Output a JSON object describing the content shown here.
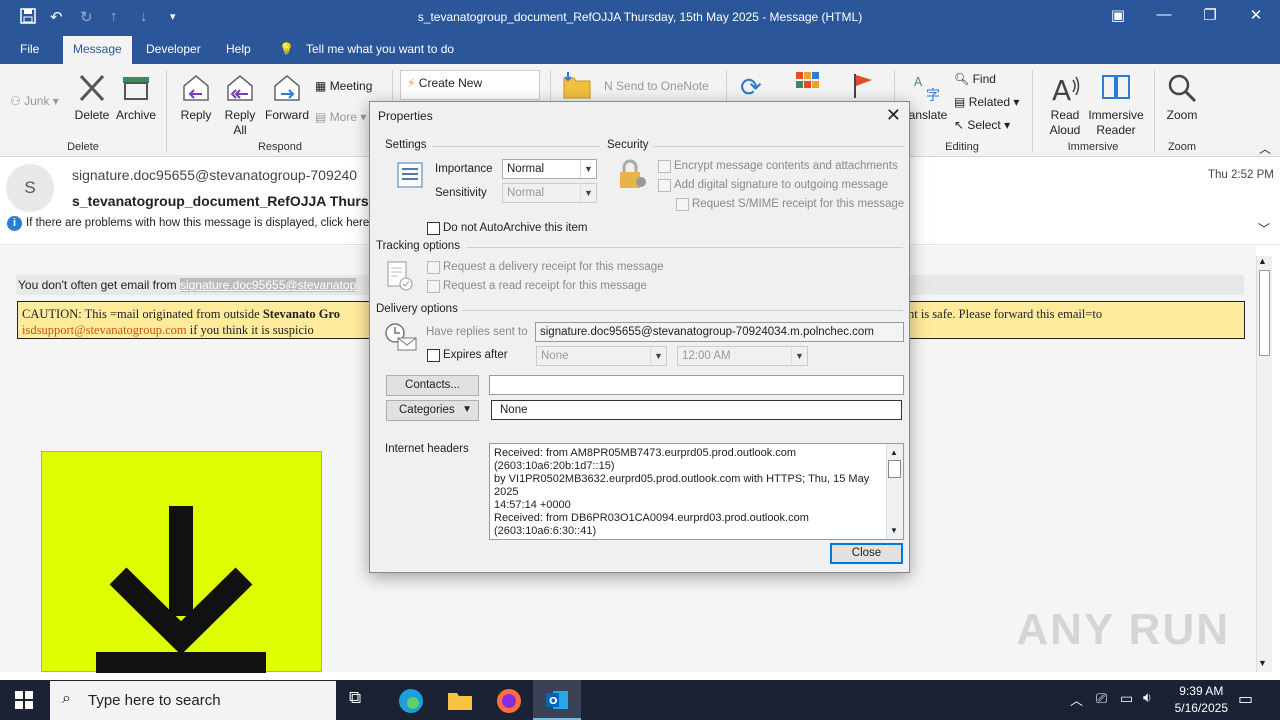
{
  "window": {
    "title": "s_tevanatogroup_document_RefOJJA Thursday, 15th May 2025  -  Message (HTML)"
  },
  "menu": {
    "items": [
      "File",
      "Message",
      "Developer",
      "Help"
    ],
    "tell_me": "Tell me what you want to do"
  },
  "ribbon": {
    "junk": "Junk",
    "delete": "Delete",
    "archive": "Archive",
    "group_delete": "Delete",
    "reply": "Reply",
    "reply_all": "Reply All",
    "forward": "Forward",
    "meeting": "Meeting",
    "more": "More",
    "group_respond": "Respond",
    "create_new": "Create New",
    "send_onenote": "Send to OneNote",
    "translate": "anslate",
    "find": "Find",
    "related": "Related",
    "select": "Select",
    "group_editing": "Editing",
    "read_aloud": "Read Aloud",
    "immersive_reader": "Immersive Reader",
    "group_immersive": "Immersive",
    "zoom": "Zoom",
    "group_zoom": "Zoom"
  },
  "message": {
    "avatar_initial": "S",
    "from": "signature.doc95655@stevanatogroup-709240",
    "subject": "s_tevanatogroup_document_RefOJJA Thursd",
    "info": "If there are problems with how this message is displayed, click here",
    "time": "Thu 2:52 PM",
    "notice_text": "You don't often get email from ",
    "notice_link": "signature.doc95655@stevanatop",
    "caution_prefix": "CAUTION: This =mail originated from outside ",
    "caution_bold": "Stevanato Gro",
    "caution_right": "nt is safe. Please forward this email=to",
    "caution_link": "isdsupport@stevanatogroup.com",
    "caution_suffix": " if you think it is suspicio"
  },
  "dialog": {
    "title": "Properties",
    "settings": "Settings",
    "importance_label": "Importance",
    "importance_value": "Normal",
    "sensitivity_label": "Sensitivity",
    "sensitivity_value": "Normal",
    "security": "Security",
    "encrypt": "Encrypt message contents and attachments",
    "digital_sig": "Add digital signature to outgoing message",
    "smime": "Request S/MIME receipt for this message",
    "autoarchive": "Do not AutoArchive this item",
    "tracking": "Tracking options",
    "delivery_receipt": "Request a delivery receipt for this message",
    "read_receipt": "Request a read receipt for this message",
    "delivery": "Delivery options",
    "replies_label": "Have replies sent to",
    "replies_value": "signature.doc95655@stevanatogroup-70924034.m.polnchec.com",
    "expires_label": "Expires after",
    "expires_date": "None",
    "expires_time": "12:00 AM",
    "contacts_btn": "Contacts...",
    "contacts_value": "",
    "categories_btn": "Categories",
    "categories_value": "None",
    "headers_label": "Internet headers",
    "headers_lines": [
      "Received: from AM8PR05MB7473.eurprd05.prod.outlook.com",
      "(2603:10a6:20b:1d7::15)",
      " by VI1PR0502MB3632.eurprd05.prod.outlook.com with HTTPS; Thu, 15 May",
      "2025",
      " 14:57:14 +0000",
      "Received: from DB6PR03O1CA0094.eurprd03.prod.outlook.com",
      "(2603:10a6:6:30::41)"
    ],
    "close_btn": "Close"
  },
  "taskbar": {
    "search_placeholder": "Type here to search",
    "time": "9:39 AM",
    "date": "5/16/2025"
  },
  "watermark": "ANY RUN",
  "colors": {
    "accent": "#2b579a",
    "caution_bg": "#ffeb9c",
    "image_bg": "#dfff00"
  }
}
